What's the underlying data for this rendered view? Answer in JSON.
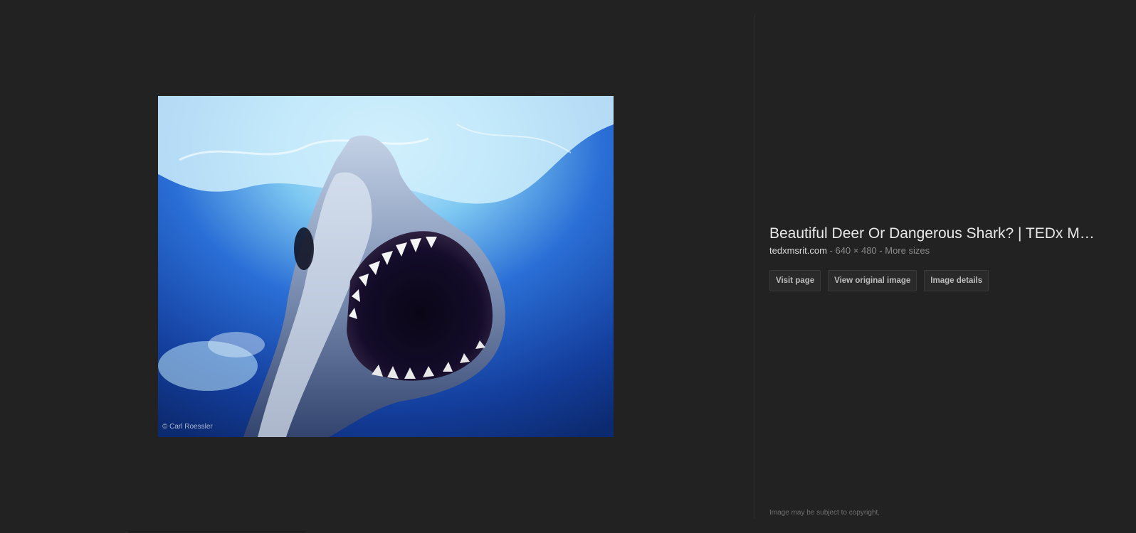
{
  "image": {
    "alt": "Great white shark with open jaws underwater",
    "watermark": "© Carl Roessler"
  },
  "details": {
    "title": "Beautiful Deer Or Dangerous Shark? | TEDx M…",
    "domain": "tedxmsrit.com",
    "separator_1": " - ",
    "dimensions": "640 × 480",
    "separator_2": " - ",
    "more_sizes": "More sizes"
  },
  "actions": {
    "visit_page": "Visit page",
    "view_original": "View original image",
    "image_details": "Image details"
  },
  "footer": {
    "copyright": "Image may be subject to copyright."
  },
  "colors": {
    "background": "#222222",
    "title": "#e8e8e8",
    "button_bg": "#2a2a2a"
  }
}
